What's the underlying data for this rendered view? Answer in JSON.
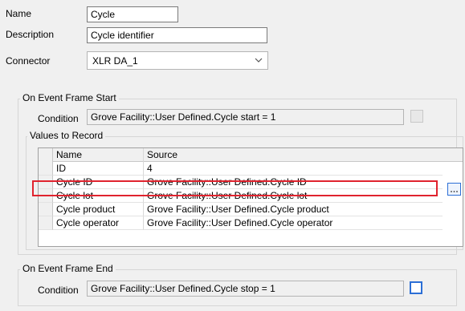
{
  "form": {
    "name_label": "Name",
    "name_value": "Cycle",
    "description_label": "Description",
    "description_value": "Cycle identifier",
    "connector_label": "Connector",
    "connector_value": "XLR DA_1"
  },
  "start_group": {
    "title": "On Event Frame Start",
    "condition_label": "Condition",
    "condition_value": "Grove Facility::User Defined.Cycle start = 1"
  },
  "values_group": {
    "title": "Values to Record",
    "columns": [
      "Name",
      "Source"
    ],
    "rows": [
      {
        "name": "ID",
        "source": "4"
      },
      {
        "name": "Cycle ID",
        "source": "Grove Facility::User Defined.Cycle ID"
      },
      {
        "name": "Cycle lot",
        "source": "Grove Facility::User Defined.Cycle lot"
      },
      {
        "name": "Cycle product",
        "source": "Grove Facility::User Defined.Cycle product"
      },
      {
        "name": "Cycle operator",
        "source": "Grove Facility::User Defined.Cycle operator"
      }
    ]
  },
  "end_group": {
    "title": "On Event Frame End",
    "condition_label": "Condition",
    "condition_value": "Grove Facility::User Defined.Cycle stop = 1"
  },
  "colors": {
    "highlight": "#e0232e",
    "active_button": "#2c6fd6"
  }
}
